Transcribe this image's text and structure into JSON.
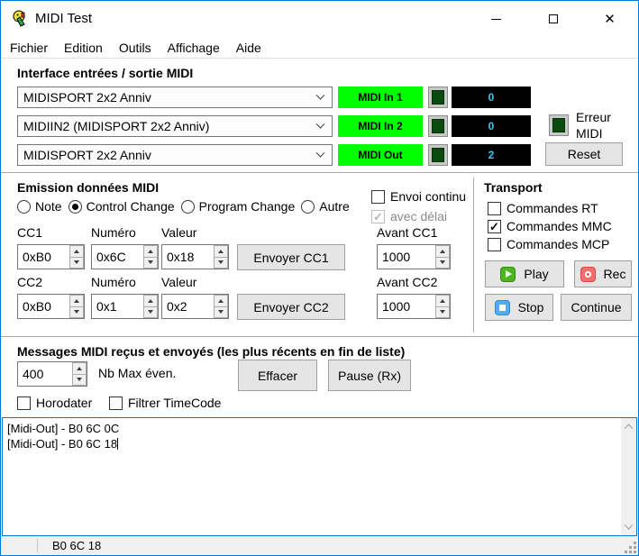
{
  "window": {
    "title": "MIDI Test"
  },
  "icons": {
    "close": "✕",
    "check": "✓"
  },
  "menu": {
    "items": [
      "Fichier",
      "Edition",
      "Outils",
      "Affichage",
      "Aide"
    ]
  },
  "io": {
    "title": "Interface entrées / sortie MIDI",
    "rows": [
      {
        "device": "MIDISPORT 2x2 Anniv",
        "label": "MIDI In 1",
        "count": "0"
      },
      {
        "device": "MIDIIN2 (MIDISPORT 2x2 Anniv)",
        "label": "MIDI In 2",
        "count": "0"
      },
      {
        "device": "MIDISPORT 2x2 Anniv",
        "label": "MIDI Out",
        "count": "2"
      }
    ],
    "error_label_line1": "Erreur",
    "error_label_line2": "MIDI",
    "reset_label": "Reset"
  },
  "emission": {
    "title": "Emission données MIDI",
    "radios": [
      {
        "label": "Note",
        "selected": false
      },
      {
        "label": "Control Change",
        "selected": true
      },
      {
        "label": "Program Change",
        "selected": false
      },
      {
        "label": "Autre",
        "selected": false
      }
    ],
    "envoi_continu_label": "Envoi continu",
    "avec_delai_label": "avec délai",
    "avec_delai_checked": true,
    "cc1": {
      "label": "CC1",
      "numero_label": "Numéro",
      "valeur_label": "Valeur",
      "status": "0xB0",
      "numero": "0x6C",
      "valeur": "0x18",
      "send_label": "Envoyer CC1",
      "avant_label": "Avant CC1",
      "avant_value": "1000"
    },
    "cc2": {
      "label": "CC2",
      "numero_label": "Numéro",
      "valeur_label": "Valeur",
      "status": "0xB0",
      "numero": "0x1",
      "valeur": "0x2",
      "send_label": "Envoyer CC2",
      "avant_label": "Avant CC2",
      "avant_value": "1000"
    }
  },
  "transport": {
    "title": "Transport",
    "checkboxes": [
      {
        "label": "Commandes RT",
        "checked": false
      },
      {
        "label": "Commandes MMC",
        "checked": true
      },
      {
        "label": "Commandes MCP",
        "checked": false
      }
    ],
    "play_label": "Play",
    "rec_label": "Rec",
    "stop_label": "Stop",
    "continue_label": "Continue"
  },
  "messages": {
    "title": "Messages MIDI reçus et envoyés (les plus récents en fin de liste)",
    "max_events_value": "400",
    "max_events_label": "Nb Max éven.",
    "effacer_label": "Effacer",
    "pause_label": "Pause (Rx)",
    "horodater_label": "Horodater",
    "filtrer_label": "Filtrer TimeCode",
    "log_lines": [
      "[Midi-Out] - B0 6C 0C",
      "[Midi-Out] - B0 6C 18"
    ]
  },
  "statusbar": {
    "text": "B0 6C 18"
  },
  "colors": {
    "accent": "#0078d7",
    "midi_label_bg": "#00ff00",
    "led": "#0b4b0d",
    "counter_bg": "#000000",
    "counter_text": "#3bc8f5"
  }
}
